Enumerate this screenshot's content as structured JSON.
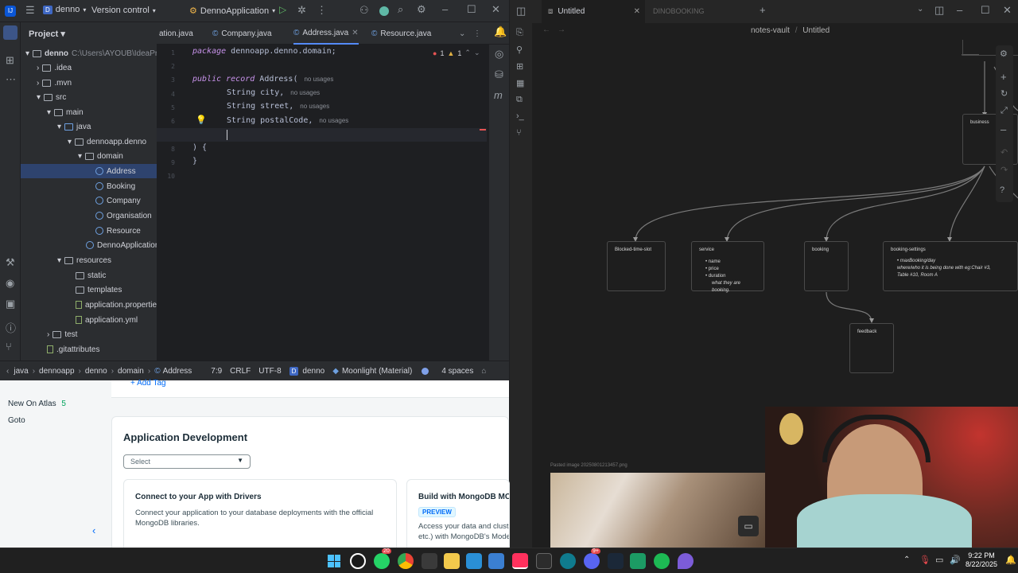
{
  "ide": {
    "project_name": "denno",
    "version_control": "Version control",
    "run_config": "DennoApplication",
    "project_label": "Project",
    "tabs": [
      {
        "label": "ation.java"
      },
      {
        "label": "Company.java"
      },
      {
        "label": "Address.java"
      },
      {
        "label": "Resource.java"
      }
    ],
    "tree": [
      {
        "label": "denno",
        "extra": "C:\\Users\\AYOUB\\IdeaPro"
      },
      {
        "label": ".idea"
      },
      {
        "label": ".mvn"
      },
      {
        "label": "src"
      },
      {
        "label": "main"
      },
      {
        "label": "java"
      },
      {
        "label": "dennoapp.denno"
      },
      {
        "label": "domain"
      },
      {
        "label": "Address"
      },
      {
        "label": "Booking"
      },
      {
        "label": "Company"
      },
      {
        "label": "Organisation"
      },
      {
        "label": "Resource"
      },
      {
        "label": "DennoApplication"
      },
      {
        "label": "resources"
      },
      {
        "label": "static"
      },
      {
        "label": "templates"
      },
      {
        "label": "application.properties"
      },
      {
        "label": "application.yml"
      },
      {
        "label": "test"
      },
      {
        "label": ".gitattributes"
      }
    ],
    "gutter": [
      "1",
      "2",
      "3",
      "4",
      "5",
      "6",
      "7",
      "8",
      "9",
      "10"
    ],
    "code": {
      "l1_kw": "package",
      "l1_rest": " dennoapp.denno.domain;",
      "l3_kw": "public record",
      "l3_rest": " Address(",
      "l4": "String city,",
      "l5": "String street,",
      "l6": "String postalCode,",
      "l8": ") {",
      "l9": "}",
      "hint": "no usages"
    },
    "errors": "1",
    "warnings": "1",
    "status": {
      "crumbs": [
        "java",
        "dennoapp",
        "denno",
        "domain",
        "Address"
      ],
      "position": "7:9",
      "line_sep": "CRLF",
      "encoding": "UTF-8",
      "project": "denno",
      "theme": "Moonlight (Material)",
      "indent": "4 spaces"
    }
  },
  "atlas": {
    "add_tag": "+ Add Tag",
    "new_on_atlas": "New On Atlas",
    "new_count": "5",
    "goto": "Goto",
    "section_title": "Application Development",
    "select_placeholder": "Select",
    "card1_title": "Connect to your App with Drivers",
    "card1_body": "Connect your application to your database deployments with the official MongoDB libraries.",
    "card2_title": "Build with MongoDB MCP Se",
    "card2_badge": "PREVIEW",
    "card2_body": "Access your data and cluste etc.) with MongoDB's Model"
  },
  "obsidian": {
    "tab_active": "Untitled",
    "tab_inactive": "DINOBOOKING",
    "breadcrumb_vault": "notes-vault",
    "breadcrumb_sep": "/",
    "breadcrumb_file": "Untitled",
    "nodes": {
      "business": "business",
      "blocked": "Blocked-time-slot",
      "service": "service",
      "service_items": [
        "name",
        "price",
        "duration"
      ],
      "service_note": "what they are booking.",
      "booking": "booking",
      "settings": "booking-settings",
      "settings_item": "maxBooking/day",
      "settings_note": "where/who it is being done with eg:Chair #3, Table #10, Room A",
      "feedback": "feedback"
    },
    "pasted_label": "Pasted image 20250801213457.png"
  },
  "taskbar": {
    "time": "9:22 PM",
    "date": "8/22/2025",
    "badge_whatsapp": "20",
    "badge_discord": "9+"
  }
}
